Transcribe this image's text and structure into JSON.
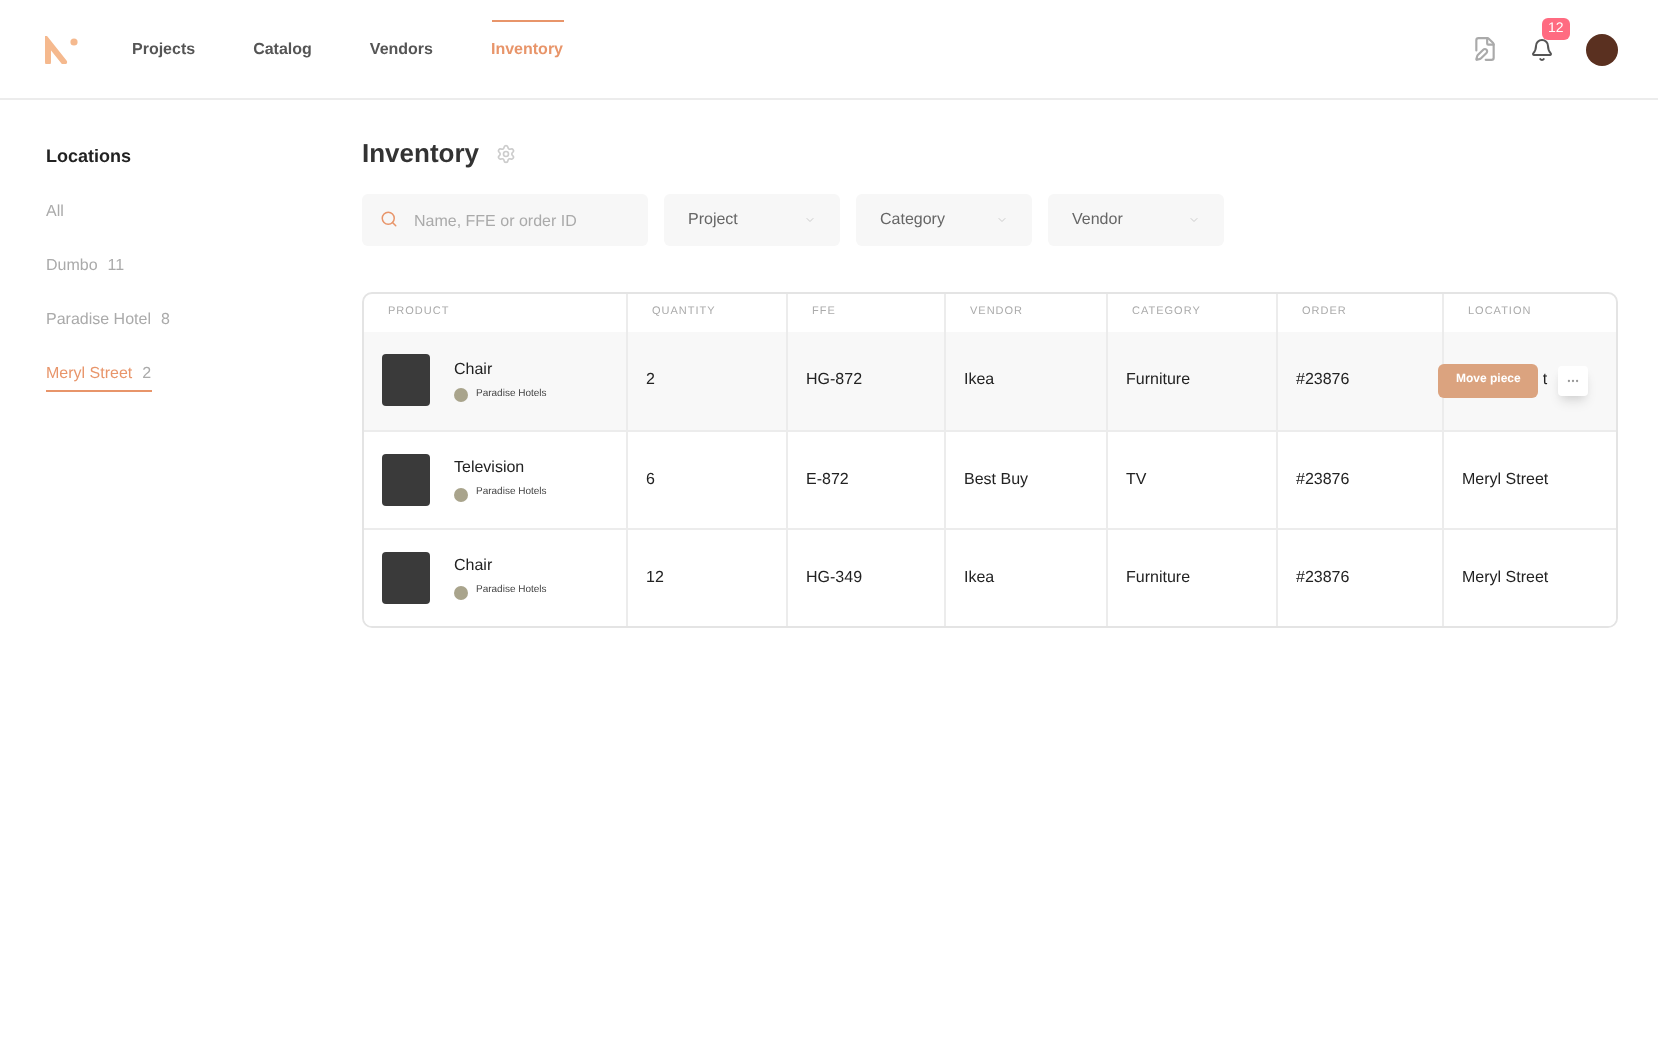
{
  "nav": {
    "items": [
      {
        "label": "Projects",
        "selected": false
      },
      {
        "label": "Catalog",
        "selected": false
      },
      {
        "label": "Vendors",
        "selected": false
      },
      {
        "label": "Inventory",
        "selected": true
      }
    ],
    "notification_count": "12"
  },
  "sidebar": {
    "title": "Locations",
    "items": [
      {
        "label": "All",
        "selected": false
      },
      {
        "label": "Dumbo",
        "count": "11",
        "selected": false
      },
      {
        "label": "Paradise Hotel",
        "count": "8",
        "selected": false
      },
      {
        "label": "Meryl Street",
        "count": "2",
        "selected": true
      }
    ]
  },
  "page": {
    "title": "Inventory"
  },
  "filters": {
    "search_placeholder": "Name, FFE or order ID",
    "dropdowns": [
      "Project",
      "Category",
      "Vendor"
    ]
  },
  "table": {
    "columns": [
      "PRODUCT",
      "QUANTITY",
      "FFE",
      "VENDOR",
      "CATEGORY",
      "ORDER",
      "LOCATION"
    ],
    "rows": [
      {
        "name": "Chair",
        "project": "Paradise Hotels",
        "quantity": "2",
        "ffe": "HG-872",
        "vendor": "Ikea",
        "category": "Furniture",
        "order": "#23876",
        "location": "t",
        "hovered": true,
        "action": "Move piece"
      },
      {
        "name": "Television",
        "project": "Paradise Hotels",
        "quantity": "6",
        "ffe": "E-872",
        "vendor": "Best Buy",
        "category": "TV",
        "order": "#23876",
        "location": "Meryl Street",
        "hovered": false
      },
      {
        "name": "Chair",
        "project": "Paradise Hotels",
        "quantity": "12",
        "ffe": "HG-349",
        "vendor": "Ikea",
        "category": "Furniture",
        "order": "#23876",
        "location": "Meryl Street",
        "hovered": false
      }
    ]
  }
}
